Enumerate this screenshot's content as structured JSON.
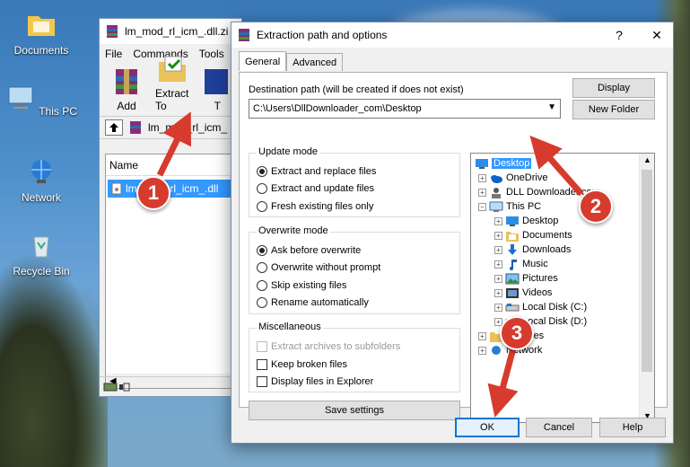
{
  "desktop": {
    "icons": [
      {
        "label": "Documents"
      },
      {
        "label": "This PC"
      },
      {
        "label": "Network"
      },
      {
        "label": "Recycle Bin"
      }
    ]
  },
  "winrar": {
    "title": "lm_mod_rl_icm_.dll.zi",
    "menu": [
      "File",
      "Commands",
      "Tools"
    ],
    "tools": [
      {
        "label": "Add"
      },
      {
        "label": "Extract To"
      },
      {
        "label": "T"
      }
    ],
    "address": "lm_mod_rl_icm_",
    "column_header": "Name",
    "file_row": "lm_mod_rl_icm_.dll"
  },
  "dialog": {
    "title": "Extraction path and options",
    "help_btn": "?",
    "close_btn": "✕",
    "tabs": [
      "General",
      "Advanced"
    ],
    "dest_label": "Destination path (will be created if does not exist)",
    "dest_value": "C:\\Users\\DllDownloader_com\\Desktop",
    "display_btn": "Display",
    "new_folder_btn": "New Folder",
    "update_mode": {
      "title": "Update mode",
      "options": [
        "Extract and replace files",
        "Extract and update files",
        "Fresh existing files only"
      ],
      "selected": 0
    },
    "overwrite_mode": {
      "title": "Overwrite mode",
      "options": [
        "Ask before overwrite",
        "Overwrite without prompt",
        "Skip existing files",
        "Rename automatically"
      ],
      "selected": 0
    },
    "misc": {
      "title": "Miscellaneous",
      "options": [
        {
          "label": "Extract archives to subfolders",
          "disabled": true
        },
        {
          "label": "Keep broken files",
          "disabled": false
        },
        {
          "label": "Display files in Explorer",
          "disabled": false
        }
      ]
    },
    "save_btn": "Save settings",
    "tree": [
      {
        "label": "Desktop",
        "level": 0,
        "selected": true,
        "icon": "desktop-icon"
      },
      {
        "label": "OneDrive",
        "level": 1,
        "icon": "onedrive-icon"
      },
      {
        "label": "DLL Downloader.com",
        "level": 1,
        "icon": "user-icon"
      },
      {
        "label": "This PC",
        "level": 1,
        "icon": "pc-icon"
      },
      {
        "label": "Desktop",
        "level": 2,
        "icon": "desktop-icon"
      },
      {
        "label": "Documents",
        "level": 2,
        "icon": "documents-icon"
      },
      {
        "label": "Downloads",
        "level": 2,
        "icon": "downloads-icon"
      },
      {
        "label": "Music",
        "level": 2,
        "icon": "music-icon"
      },
      {
        "label": "Pictures",
        "level": 2,
        "icon": "pictures-icon"
      },
      {
        "label": "Videos",
        "level": 2,
        "icon": "videos-icon"
      },
      {
        "label": "Local Disk (C:)",
        "level": 2,
        "icon": "drive-icon"
      },
      {
        "label": "Local Disk (D:)",
        "level": 2,
        "icon": "drive-icon"
      },
      {
        "label": "Libraries",
        "level": 1,
        "icon": "libraries-icon"
      },
      {
        "label": "Network",
        "level": 1,
        "icon": "network-icon"
      }
    ],
    "ok_btn": "OK",
    "cancel_btn": "Cancel",
    "help_bottom_btn": "Help"
  },
  "callouts": [
    "1",
    "2",
    "3"
  ],
  "colors": {
    "callout": "#d63b2e",
    "selection": "#3399ff",
    "ok_border": "#0078d7"
  }
}
